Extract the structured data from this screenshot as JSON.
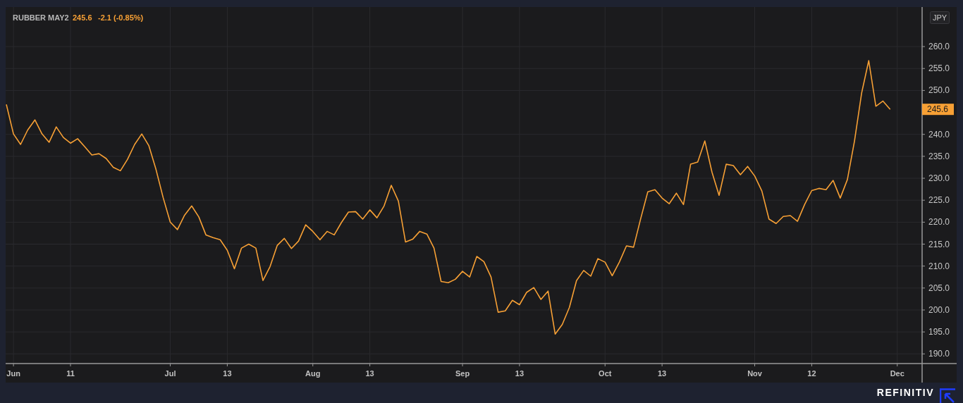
{
  "header": {
    "price": "245.6",
    "change": "-2.1 (-0.85%)"
  },
  "currency_badge": "JPY",
  "last_price_tag": "245.6",
  "chart_data": {
    "type": "line",
    "grid": true,
    "categories": [
      null,
      "Jun",
      null,
      null,
      null,
      null,
      null,
      null,
      null,
      "11",
      null,
      null,
      null,
      null,
      null,
      null,
      null,
      null,
      null,
      null,
      null,
      null,
      null,
      "Jul",
      null,
      null,
      null,
      null,
      null,
      null,
      null,
      "13",
      null,
      null,
      null,
      null,
      null,
      null,
      null,
      null,
      null,
      null,
      null,
      "Aug",
      null,
      null,
      null,
      null,
      null,
      null,
      null,
      "13",
      null,
      null,
      null,
      null,
      null,
      null,
      null,
      null,
      null,
      null,
      null,
      null,
      "Sep",
      null,
      null,
      null,
      null,
      null,
      null,
      null,
      "13",
      null,
      null,
      null,
      null,
      null,
      null,
      null,
      null,
      null,
      null,
      null,
      "Oct",
      null,
      null,
      null,
      null,
      null,
      null,
      null,
      "13",
      null,
      null,
      null,
      null,
      null,
      null,
      null,
      null,
      null,
      null,
      null,
      null,
      "Nov",
      null,
      null,
      null,
      null,
      null,
      null,
      null,
      "12",
      null,
      null,
      null,
      null,
      null,
      null,
      null,
      null,
      null,
      null,
      null,
      "Dec"
    ],
    "series": [
      {
        "name": "RUBBER MAY2",
        "color": "#f7a035",
        "values": [
          246.8,
          240.1,
          237.7,
          241,
          243.3,
          240.1,
          238.2,
          241.7,
          239.3,
          238,
          239,
          237.2,
          235.3,
          235.6,
          234.5,
          232.5,
          231.7,
          234.3,
          237.7,
          240.1,
          237.4,
          232,
          225.6,
          220,
          218.3,
          221.6,
          223.7,
          221.2,
          217.1,
          216.5,
          216,
          213.6,
          209.4,
          214.1,
          215,
          214.1,
          206.7,
          209.9,
          214.7,
          216.3,
          214,
          215.7,
          219.4,
          217.9,
          216,
          217.9,
          217.1,
          219.9,
          222.3,
          222.4,
          220.7,
          222.8,
          221,
          223.7,
          228.4,
          224.8,
          215.5,
          216.1,
          217.9,
          217.3,
          214.1,
          206.5,
          206.2,
          207,
          208.8,
          207.5,
          212.2,
          211,
          207.5,
          199.5,
          199.8,
          202.2,
          201.2,
          204,
          205.1,
          202.4,
          204.3,
          194.5,
          196.7,
          200.6,
          206.7,
          209,
          207.7,
          211.7,
          210.9,
          207.8,
          210.9,
          214.6,
          214.3,
          220.8,
          226.9,
          227.4,
          225.5,
          224.2,
          226.6,
          224,
          233.2,
          233.7,
          238.5,
          231.4,
          226.1,
          233.2,
          232.9,
          230.8,
          232.7,
          230.5,
          227.1,
          220.7,
          219.7,
          221.3,
          221.5,
          220.2,
          224,
          227.2,
          227.7,
          227.4,
          229.5,
          225.5,
          229.7,
          238.5,
          249.4,
          256.8,
          246.4,
          247.6,
          245.7,
          null
        ]
      }
    ],
    "ylim": [
      187.8,
      269
    ],
    "yticks": [
      {
        "value": 190,
        "label": "190.0"
      },
      {
        "value": 195,
        "label": "195.0"
      },
      {
        "value": 200,
        "label": "200.0"
      },
      {
        "value": 205,
        "label": "205.0"
      },
      {
        "value": 210,
        "label": "210.0"
      },
      {
        "value": 215,
        "label": "215.0"
      },
      {
        "value": 220,
        "label": "220.0"
      },
      {
        "value": 225,
        "label": "225.0"
      },
      {
        "value": 230,
        "label": "230.0"
      },
      {
        "value": 235,
        "label": "235.0"
      },
      {
        "value": 240,
        "label": "240.0"
      },
      {
        "value": 250,
        "label": "250.0"
      },
      {
        "value": 255,
        "label": "255.0"
      },
      {
        "value": 260,
        "label": "260.0"
      }
    ]
  },
  "brand": "REFINITIV"
}
